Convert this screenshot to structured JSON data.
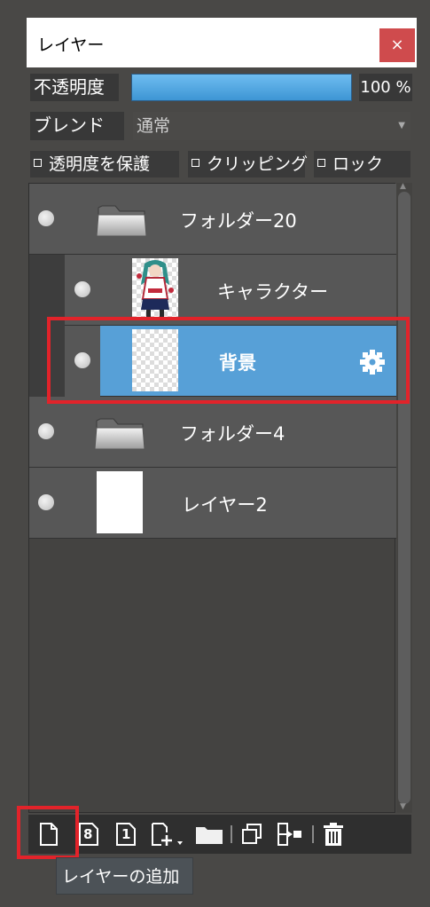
{
  "window": {
    "title": "レイヤー",
    "close_label": "×"
  },
  "opacity": {
    "label": "不透明度",
    "value_text": "100 %",
    "fill_fraction": 1.0
  },
  "blend": {
    "label": "ブレンド",
    "value": "通常"
  },
  "checkboxes": {
    "protect_alpha": {
      "label": "透明度を保護",
      "checked": false
    },
    "clipping": {
      "label": "クリッピング",
      "checked": false
    },
    "lock": {
      "label": "ロック",
      "checked": false
    }
  },
  "layers": [
    {
      "name": "フォルダー20",
      "type": "folder",
      "selected": false
    },
    {
      "name": "キャラクター",
      "type": "image",
      "selected": false
    },
    {
      "name": "背景",
      "type": "layer",
      "selected": true
    },
    {
      "name": "フォルダー4",
      "type": "folder",
      "selected": false
    },
    {
      "name": "レイヤー2",
      "type": "layer",
      "selected": false
    }
  ],
  "toolbar": {
    "buttons": [
      "new-layer-icon",
      "new-8bit-layer-icon",
      "new-1bit-layer-icon",
      "add-layer-menu-icon",
      "new-folder-icon",
      "duplicate-layer-icon",
      "merge-down-icon",
      "delete-layer-icon"
    ],
    "label_8bit": "8",
    "label_1bit": "1"
  },
  "tooltip": {
    "text": "レイヤーの追加"
  },
  "colors": {
    "accent": "#57a0d7",
    "highlight": "#e2232a",
    "close": "#cf4b4d"
  }
}
